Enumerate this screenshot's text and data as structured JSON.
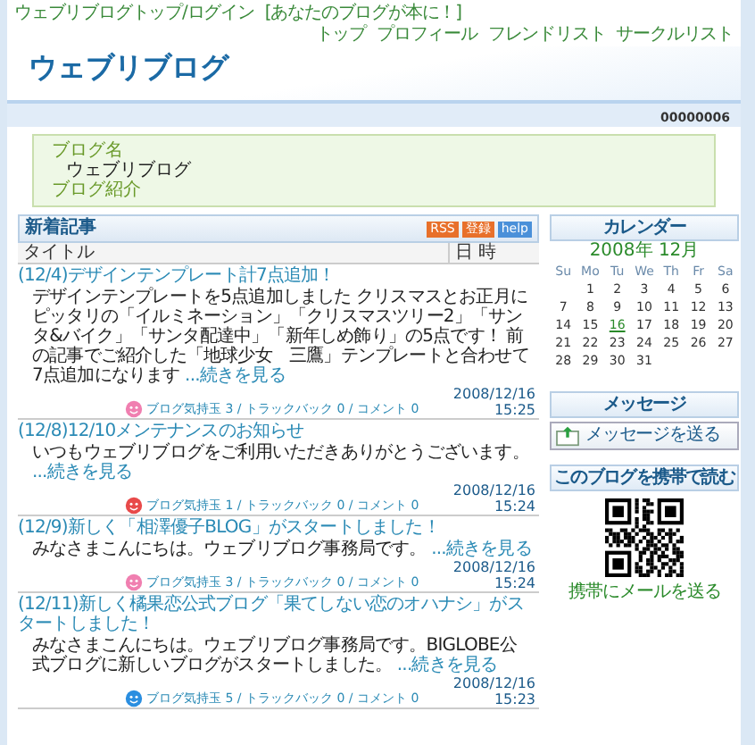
{
  "top_bar": {
    "left_links": [
      "ウェブリブログトップ/ログイン",
      "[あなたのブログが本に！]"
    ],
    "right_links": [
      "トップ",
      "プロフィール",
      "フレンドリスト",
      "サークルリスト"
    ]
  },
  "header": {
    "title": "ウェブリブログ",
    "counter": "00000006"
  },
  "blog_info": {
    "name_label": "ブログ名",
    "name": "ウェブリブログ",
    "intro_label": "ブログ紹介"
  },
  "articles_panel": {
    "title": "新着記事",
    "badges": [
      {
        "label": "RSS",
        "color": "#e8702a"
      },
      {
        "label": "登録",
        "color": "#e8702a"
      },
      {
        "label": "help",
        "color": "#4a90d9"
      }
    ],
    "columns": [
      "タイトル",
      "日 時"
    ],
    "articles": [
      {
        "title": "(12/4)デザインテンプレート計7点追加！",
        "body": "デザインテンプレートを5点追加しました クリスマスとお正月にピッタリの「イルミネーション」「クリスマスツリー2」「サンタ&バイク」「サンタ配達中」「新年しめ飾り」の5点です！ 前の記事でご紹介した「地球少女　三鷹」テンプレートと合わせて7点追加になります",
        "more": "...続きを見る",
        "meta": "ブログ気持玉 3 / トラックバック 0 / コメント 0",
        "color": "#f07fb0",
        "date": "2008/12/16",
        "time": "15:25"
      },
      {
        "title": "(12/8)12/10メンテナンスのお知らせ",
        "body": "いつもウェブリブログをご利用いただきありがとうございます。",
        "more": "...続きを見る",
        "meta": "ブログ気持玉 1 / トラックバック 0 / コメント 0",
        "color": "#e84a4a",
        "date": "2008/12/16",
        "time": "15:24"
      },
      {
        "title": "(12/9)新しく「相澤優子BLOG」がスタートしました！",
        "body": "みなさまこんにちは。ウェブリブログ事務局です。",
        "more": "...続きを見る",
        "meta": "ブログ気持玉 3 / トラックバック 0 / コメント 0",
        "color": "#f07fb0",
        "date": "2008/12/16",
        "time": "15:24"
      },
      {
        "title": "(12/11)新しく橘果恋公式ブログ「果てしない恋のオハナシ」がスタートしました！",
        "body": "みなさまこんにちは。ウェブリブログ事務局です。BIGLOBE公式ブログに新しいブログがスタートしました。",
        "more": "...続きを見る",
        "meta": "ブログ気持玉 5 / トラックバック 0 / コメント 0",
        "color": "#2a8ee0",
        "date": "2008/12/16",
        "time": "15:23"
      }
    ]
  },
  "sidebar": {
    "calendar": {
      "title": "カレンダー",
      "month": "2008年 12月",
      "weekdays": [
        "Su",
        "Mo",
        "Tu",
        "We",
        "Th",
        "Fr",
        "Sa"
      ],
      "weeks": [
        {
          "days": [
            {
              "day": "1",
              "selected": false
            },
            {
              "day": "2",
              "selected": false
            },
            {
              "day": "3",
              "selected": false
            },
            {
              "day": "4",
              "selected": false
            },
            {
              "day": "5",
              "selected": false
            },
            {
              "day": "6",
              "selected": false
            }
          ]
        },
        {
          "days": [
            {
              "day": "7",
              "selected": false
            },
            {
              "day": "8",
              "selected": false
            },
            {
              "day": "9",
              "selected": false
            },
            {
              "day": "10",
              "selected": false
            },
            {
              "day": "11",
              "selected": false
            },
            {
              "day": "12",
              "selected": false
            },
            {
              "day": "13",
              "selected": false
            }
          ]
        },
        {
          "days": [
            {
              "day": "14",
              "selected": false
            },
            {
              "day": "15",
              "selected": false
            },
            {
              "day": "16",
              "selected": true
            },
            {
              "day": "17",
              "selected": false
            },
            {
              "day": "18",
              "selected": false
            },
            {
              "day": "19",
              "selected": false
            },
            {
              "day": "20",
              "selected": false
            }
          ]
        },
        {
          "days": [
            {
              "day": "21",
              "selected": false
            },
            {
              "day": "22",
              "selected": false
            },
            {
              "day": "23",
              "selected": false
            },
            {
              "day": "24",
              "selected": false
            },
            {
              "day": "25",
              "selected": false
            },
            {
              "day": "26",
              "selected": false
            },
            {
              "day": "27",
              "selected": false
            }
          ]
        },
        {
          "days": [
            {
              "day": "28",
              "selected": false
            },
            {
              "day": "29",
              "selected": false
            },
            {
              "day": "30",
              "selected": false
            },
            {
              "day": "31",
              "selected": false
            }
          ]
        }
      ]
    },
    "message": {
      "title": "メッセージ",
      "button": "メッセージを送る"
    },
    "mobile": {
      "title": "このブログを携帯で読む",
      "link": "携帯にメールを送る"
    }
  }
}
